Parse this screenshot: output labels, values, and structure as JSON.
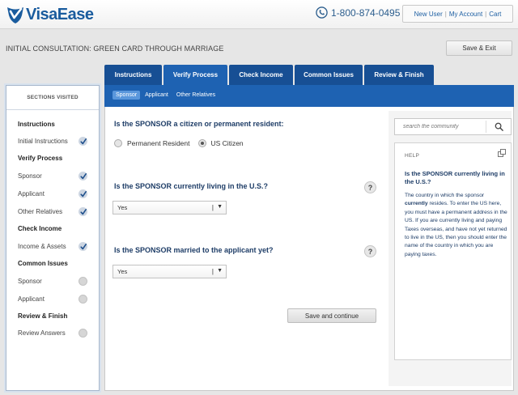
{
  "brand": {
    "name": "VisaEase",
    "phone": "1-800-874-0495"
  },
  "account_links": {
    "new_user": "New User",
    "my_account": "My Account",
    "cart": "Cart",
    "separator": "|"
  },
  "page": {
    "title": "INITIAL CONSULTATION: GREEN CARD THROUGH MARRIAGE",
    "save_exit": "Save & Exit"
  },
  "tabs": [
    {
      "label": "Instructions",
      "active": false
    },
    {
      "label": "Verify Process",
      "active": true
    },
    {
      "label": "Check Income",
      "active": false
    },
    {
      "label": "Common Issues",
      "active": false
    },
    {
      "label": "Review & Finish",
      "active": false
    }
  ],
  "subtabs": [
    {
      "label": "Sponsor",
      "active": true
    },
    {
      "label": "Applicant",
      "active": false
    },
    {
      "label": "Other Relatives",
      "active": false
    }
  ],
  "sidebar": {
    "title": "SECTIONS VISITED",
    "items": [
      {
        "label": "Instructions",
        "type": "heading"
      },
      {
        "label": "Initial Instructions",
        "type": "item",
        "status": "done"
      },
      {
        "label": "Verify Process",
        "type": "heading"
      },
      {
        "label": "Sponsor",
        "type": "item",
        "status": "done"
      },
      {
        "label": "Applicant",
        "type": "item",
        "status": "done"
      },
      {
        "label": "Other Relatives",
        "type": "item",
        "status": "done"
      },
      {
        "label": "Check Income",
        "type": "heading"
      },
      {
        "label": "Income & Assets",
        "type": "item",
        "status": "done"
      },
      {
        "label": "Common Issues",
        "type": "heading"
      },
      {
        "label": "Sponsor",
        "type": "item",
        "status": "todo"
      },
      {
        "label": "Applicant",
        "type": "item",
        "status": "todo"
      },
      {
        "label": "Review & Finish",
        "type": "heading"
      },
      {
        "label": "Review Answers",
        "type": "item",
        "status": "todo"
      }
    ]
  },
  "form": {
    "q1": {
      "label": "Is the SPONSOR a citizen or permanent resident:",
      "options": [
        "Permanent Resident",
        "US Citizen"
      ],
      "selected": "US Citizen"
    },
    "q2": {
      "label": "Is the SPONSOR currently living in the U.S.?",
      "value": "Yes"
    },
    "q3": {
      "label": "Is the SPONSOR married to the applicant yet?",
      "value": "Yes"
    },
    "help_glyph": "?",
    "continue": "Save and continue"
  },
  "search": {
    "placeholder": "search the community"
  },
  "help": {
    "title": "HELP",
    "question": "Is the SPONSOR currently living in the U.S.?",
    "body_1": "The country in which the sponsor ",
    "body_em": "currently",
    "body_2": " resides. To enter the US here, you must have a permanent address in the US. If you are currently living and paying Taxes overseas, and have not yet returned to live in the US, then you should enter the name of the country in which you are paying taxes."
  },
  "colors": {
    "brand_blue": "#1a5c9e",
    "tab_blue": "#174f94",
    "active_blue": "#1e62b2",
    "heading_navy": "#1e3d67"
  }
}
